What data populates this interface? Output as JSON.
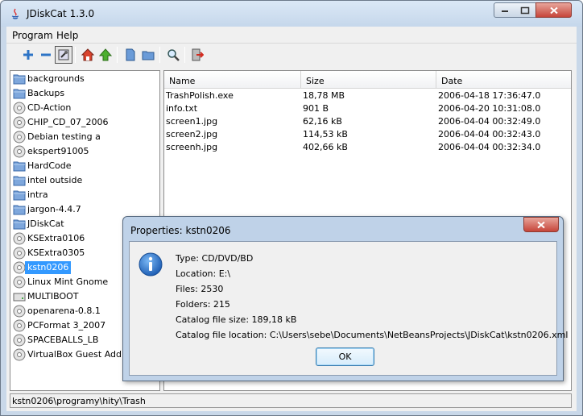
{
  "window": {
    "title": "JDiskCat 1.3.0"
  },
  "menubar": {
    "items": [
      "Program",
      "Help"
    ]
  },
  "toolbar": {
    "buttons": [
      "add-icon",
      "remove-icon",
      "settings-icon",
      "home-icon",
      "up-icon",
      "open-icon",
      "folder-icon",
      "search-icon",
      "exit-icon"
    ]
  },
  "tree": {
    "items": [
      {
        "label": "backgrounds",
        "type": "folder"
      },
      {
        "label": "Backups",
        "type": "folder"
      },
      {
        "label": "CD-Action",
        "type": "cd"
      },
      {
        "label": "CHIP_CD_07_2006",
        "type": "cd"
      },
      {
        "label": "Debian testing a",
        "type": "cd"
      },
      {
        "label": "ekspert91005",
        "type": "cd"
      },
      {
        "label": "HardCode",
        "type": "folder"
      },
      {
        "label": "intel outside",
        "type": "folder"
      },
      {
        "label": "intra",
        "type": "folder"
      },
      {
        "label": "jargon-4.4.7",
        "type": "folder"
      },
      {
        "label": "JDiskCat",
        "type": "folder"
      },
      {
        "label": "KSExtra0106",
        "type": "cd"
      },
      {
        "label": "KSExtra0305",
        "type": "cd"
      },
      {
        "label": "kstn0206",
        "type": "cd",
        "selected": true
      },
      {
        "label": "Linux Mint Gnome",
        "type": "cd"
      },
      {
        "label": "MULTIBOOT",
        "type": "drive"
      },
      {
        "label": "openarena-0.8.1",
        "type": "cd"
      },
      {
        "label": "PCFormat 3_2007",
        "type": "cd"
      },
      {
        "label": "SPACEBALLS_LB",
        "type": "cd"
      },
      {
        "label": "VirtualBox Guest Additions",
        "type": "cd"
      }
    ]
  },
  "table": {
    "columns": [
      "Name",
      "Size",
      "Date"
    ],
    "rows": [
      [
        "TrashPolish.exe",
        "18,78 MB",
        "2006-04-18 17:36:47.0"
      ],
      [
        "info.txt",
        "901 B",
        "2006-04-20 10:31:08.0"
      ],
      [
        "screen1.jpg",
        "62,16 kB",
        "2006-04-04 00:32:49.0"
      ],
      [
        "screen2.jpg",
        "114,53 kB",
        "2006-04-04 00:32:43.0"
      ],
      [
        "screenh.jpg",
        "402,66 kB",
        "2006-04-04 00:32:34.0"
      ]
    ]
  },
  "status": {
    "path": "kstn0206\\programy\\hity\\Trash"
  },
  "dialog": {
    "title": "Properties: kstn0206",
    "lines": [
      "Type: CD/DVD/BD",
      "Location: E:\\",
      "Files: 2530",
      "Folders: 215",
      "Catalog file size: 189,18 kB",
      "Catalog file location: C:\\Users\\sebe\\Documents\\NetBeansProjects\\JDiskCat\\kstn0206.xml"
    ],
    "ok_label": "OK"
  },
  "colors": {
    "selection": "#3399ff",
    "dialog_frame": "#bfd2e8",
    "window_frame": "#c9d8e9"
  }
}
